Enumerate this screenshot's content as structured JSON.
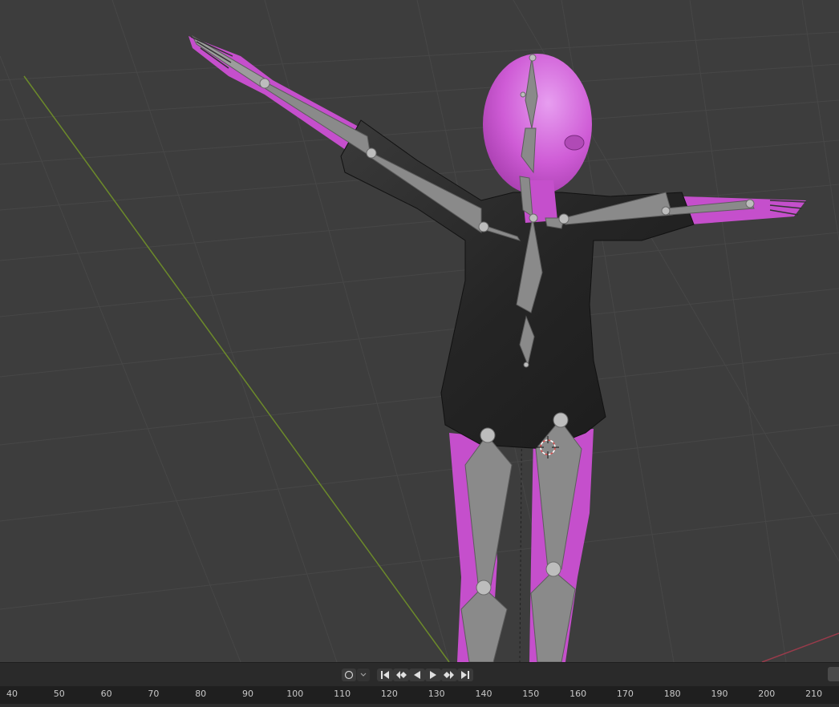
{
  "app": "Blender",
  "viewport": {
    "grid_color": "#555555",
    "y_axis_color": "#6c8a2a",
    "x_axis_color": "#9a3b4b",
    "bone_color": "#8a8a8a",
    "skin_color": "#d25ed6",
    "jacket_color": "#2b2b2b"
  },
  "playback": {
    "keying_icon": "record-circle-icon",
    "buttons": [
      {
        "name": "jump-start",
        "icon": "jump-to-start-icon"
      },
      {
        "name": "prev-keyframe",
        "icon": "prev-keyframe-icon"
      },
      {
        "name": "play-reverse",
        "icon": "play-reverse-icon"
      },
      {
        "name": "play",
        "icon": "play-icon"
      },
      {
        "name": "next-keyframe",
        "icon": "next-keyframe-icon"
      },
      {
        "name": "jump-end",
        "icon": "jump-to-end-icon"
      }
    ]
  },
  "timeline": {
    "ticks": [
      "40",
      "50",
      "60",
      "70",
      "80",
      "90",
      "100",
      "110",
      "120",
      "130",
      "140",
      "150",
      "160",
      "170",
      "180",
      "190",
      "200",
      "210"
    ]
  }
}
